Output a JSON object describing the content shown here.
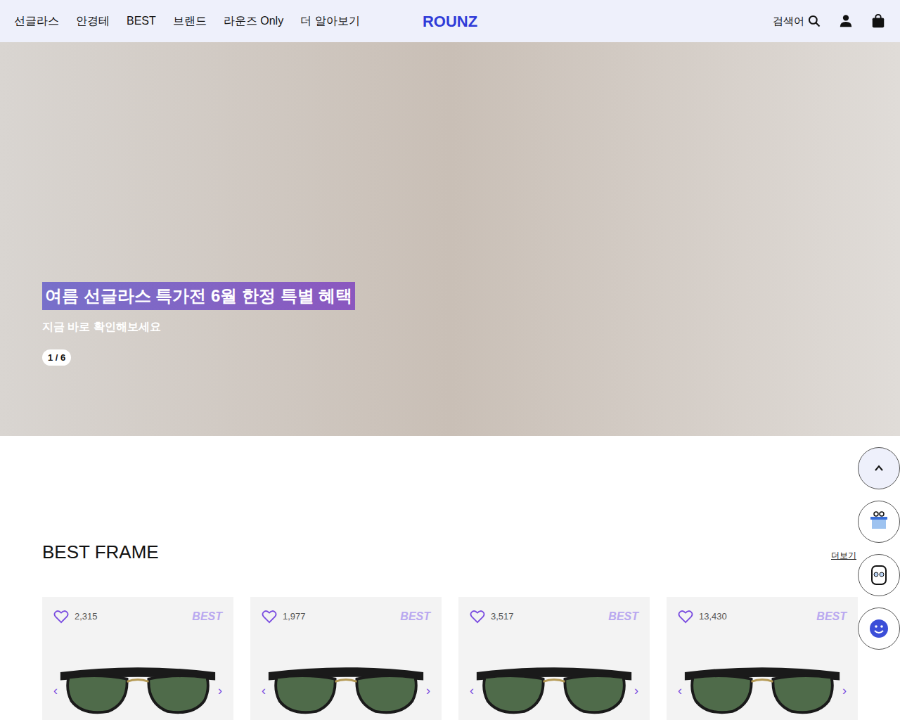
{
  "header": {
    "nav": [
      {
        "label": "선글라스"
      },
      {
        "label": "안경테"
      },
      {
        "label": "BEST"
      },
      {
        "label": "브랜드"
      },
      {
        "label": "라운즈 Only"
      },
      {
        "label": "더 알아보기"
      }
    ],
    "logo": "ROUNZ",
    "search_placeholder": "검색어"
  },
  "hero": {
    "title": "여름 선글라스 특가전 6월 한정 특별 혜택",
    "subtitle": "지금 바로 확인해보세요",
    "pager": "1 / 6"
  },
  "side": {
    "more": "더보기"
  },
  "section": {
    "title": "BEST FRAME",
    "products": [
      {
        "likes": "2,315",
        "badge": "BEST",
        "liked": false
      },
      {
        "likes": "1,977",
        "badge": "BEST",
        "liked": false
      },
      {
        "likes": "3,517",
        "badge": "BEST",
        "liked": false
      },
      {
        "likes": "13,430",
        "badge": "BEST",
        "liked": false
      }
    ]
  }
}
